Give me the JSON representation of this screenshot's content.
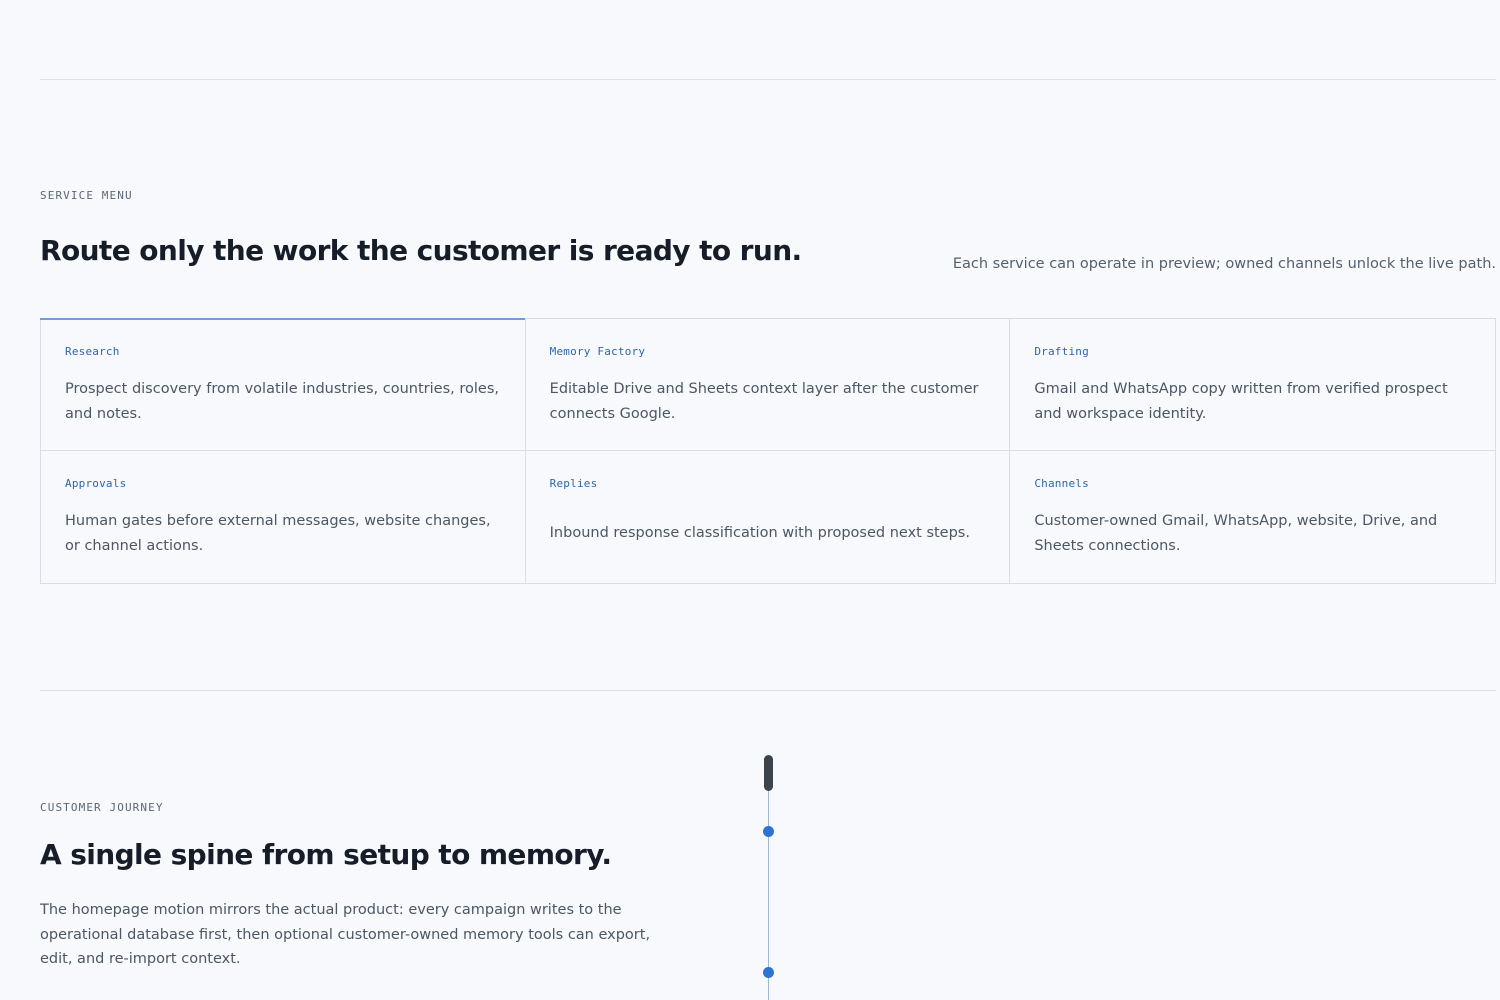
{
  "service_menu": {
    "eyebrow": "SERVICE MENU",
    "heading": "Route only the work the customer is ready to run.",
    "aside": "Each service can operate in preview; owned channels unlock the live path.",
    "cards": [
      {
        "title": "Research",
        "description": "Prospect discovery from volatile industries, countries, roles, and notes."
      },
      {
        "title": "Memory Factory",
        "description": "Editable Drive and Sheets context layer after the customer connects Google."
      },
      {
        "title": "Drafting",
        "description": "Gmail and WhatsApp copy written from verified prospect and workspace identity."
      },
      {
        "title": "Approvals",
        "description": "Human gates before external messages, website changes, or channel actions."
      },
      {
        "title": "Replies",
        "description": "Inbound response classification with proposed next steps."
      },
      {
        "title": "Channels",
        "description": "Customer-owned Gmail, WhatsApp, website, Drive, and Sheets connections."
      }
    ]
  },
  "customer_journey": {
    "eyebrow": "CUSTOMER JOURNEY",
    "heading": "A single spine from setup to memory.",
    "description": "The homepage motion mirrors the actual product: every campaign writes to the operational database first, then optional customer-owned memory tools can export, edit, and re-import context."
  },
  "colors": {
    "background": "#f7f9fc",
    "accent": "#2f73d0",
    "card_title": "#2d66a8",
    "border": "#d9dee6"
  }
}
